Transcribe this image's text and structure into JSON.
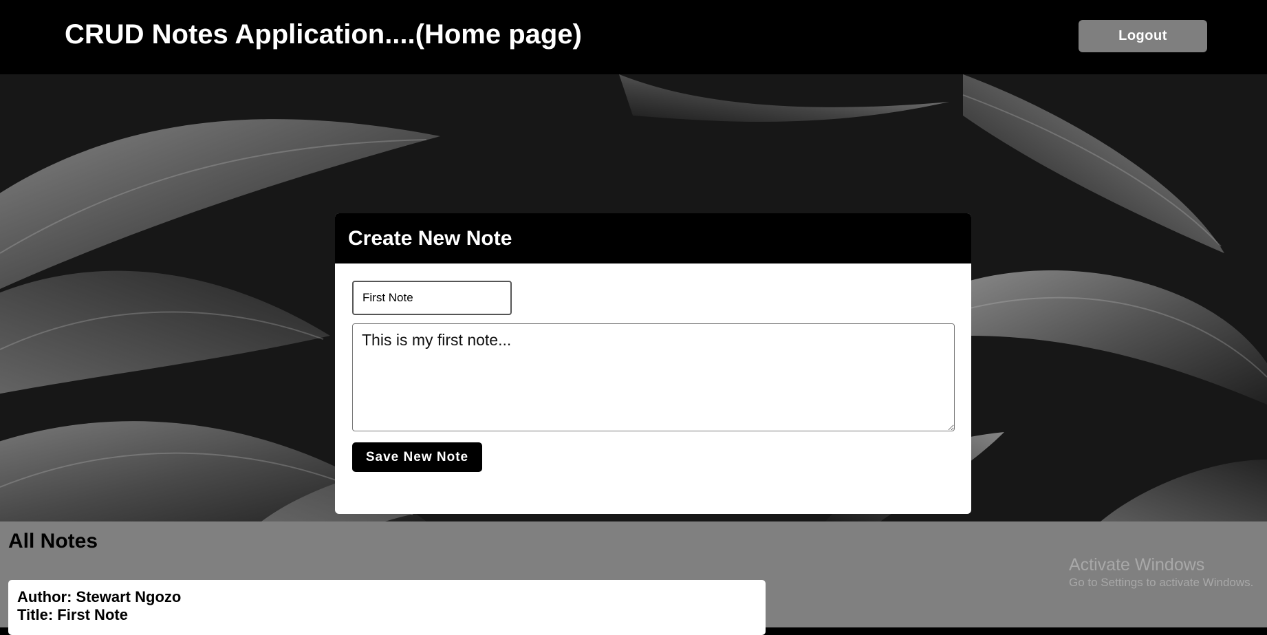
{
  "header": {
    "title": "CRUD Notes Application....(Home page)",
    "logout_label": "Logout"
  },
  "create_card": {
    "heading": "Create New Note",
    "title_value": "First Note",
    "body_value": "This is my first note...",
    "save_label": "Save New Note"
  },
  "notes": {
    "heading": "All Notes",
    "items": [
      {
        "author": "Author: Stewart Ngozo",
        "title": "Title: First Note"
      }
    ]
  },
  "watermark": {
    "line1": "Activate Windows",
    "line2": "Go to Settings to activate Windows."
  },
  "colors": {
    "topbar": "#000000",
    "logout_button": "#7f7f7f",
    "notes_background": "#808080",
    "card_header": "#000000"
  },
  "background_image": "dark monochrome tropical leaves"
}
